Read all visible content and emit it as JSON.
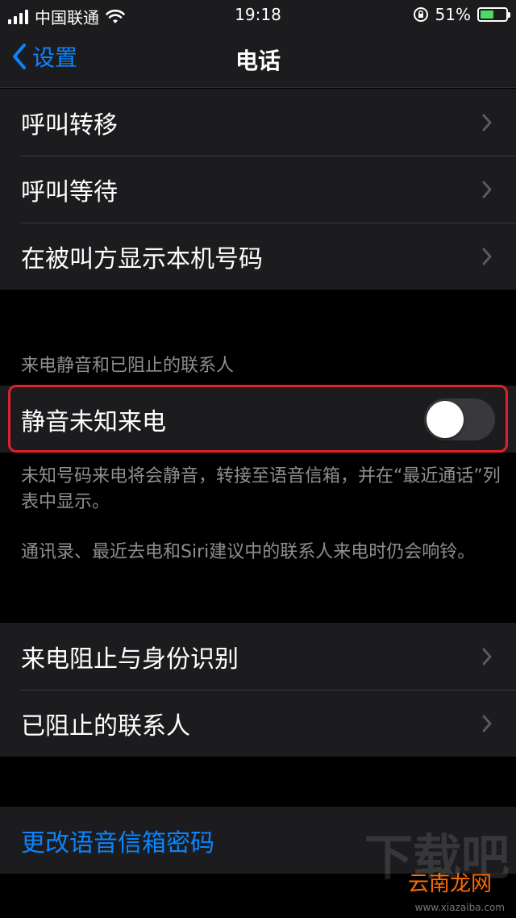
{
  "status_bar": {
    "carrier": "中国联通",
    "time": "19:18",
    "battery": "51%",
    "battery_level": 0.51,
    "icons": [
      "signal-icon",
      "wifi-icon",
      "orientation-lock-icon",
      "battery-icon"
    ]
  },
  "nav": {
    "back_label": "设置",
    "title": "电话"
  },
  "group1": {
    "items": [
      {
        "label": "呼叫转移"
      },
      {
        "label": "呼叫等待"
      },
      {
        "label": "在被叫方显示本机号码"
      }
    ]
  },
  "silence_section": {
    "header": "来电静音和已阻止的联系人",
    "toggle_label": "静音未知来电",
    "toggle_on": false,
    "footer_1": "未知号码来电将会静音，转接至语音信箱，并在“最近通话”列表中显示。",
    "footer_2": "通讯录、最近去电和Siri建议中的联系人来电时仍会响铃。"
  },
  "group2": {
    "items": [
      {
        "label": "来电阻止与身份识别"
      },
      {
        "label": "已阻止的联系人"
      }
    ]
  },
  "group3": {
    "voicemail_label": "更改语音信箱密码"
  },
  "watermark": {
    "brand": "云南龙网",
    "bg_text": "下载吧",
    "site": "www.xiazaiba.com"
  },
  "colors": {
    "accent": "#0a84ff",
    "highlight": "#e0202a",
    "cell_bg": "#1c1c1e"
  }
}
